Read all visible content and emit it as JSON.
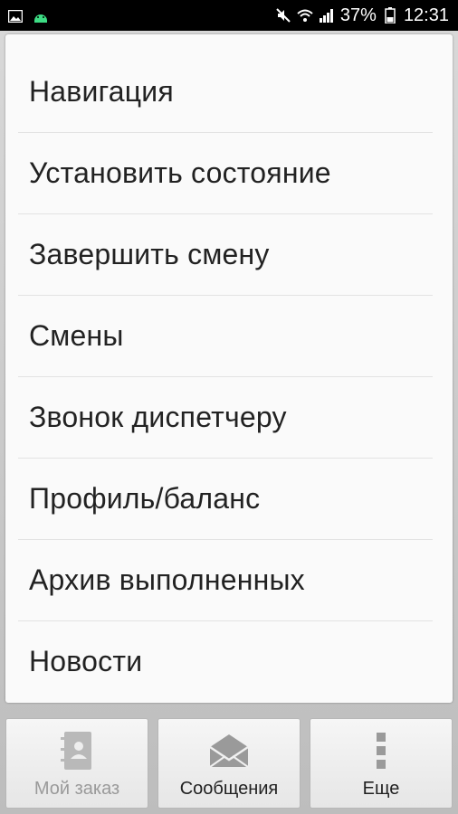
{
  "status_bar": {
    "battery_percent": "37%",
    "time": "12:31",
    "icons": [
      "image-icon",
      "android-icon",
      "mute-icon",
      "wifi-icon",
      "signal-icon",
      "battery-icon"
    ]
  },
  "menu": {
    "items": [
      {
        "label": "Навигация"
      },
      {
        "label": "Установить состояние"
      },
      {
        "label": "Завершить смену"
      },
      {
        "label": "Смены"
      },
      {
        "label": "Звонок диспетчеру"
      },
      {
        "label": "Профиль/баланс"
      },
      {
        "label": "Архив выполненных"
      },
      {
        "label": "Новости"
      }
    ]
  },
  "bottom_bar": {
    "my_order": {
      "label": "Мой заказ",
      "icon": "contacts-book-icon",
      "enabled": false
    },
    "messages": {
      "label": "Сообщения",
      "icon": "envelope-icon",
      "enabled": true
    },
    "more": {
      "label": "Еще",
      "icon": "more-vertical-icon",
      "enabled": true
    }
  },
  "colors": {
    "status_bar_bg": "#000000",
    "menu_bg": "#fafafa",
    "divider": "#e3e3e3",
    "text": "#222222",
    "disabled_text": "#9a9a9a"
  }
}
